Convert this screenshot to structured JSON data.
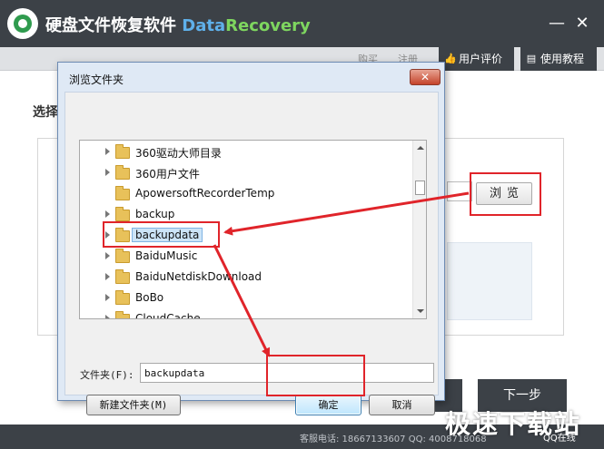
{
  "app": {
    "title_cn": "硬盘文件恢复软件",
    "title_data": "Data",
    "title_recovery": "Recovery",
    "minimize_glyph": "—",
    "close_glyph": "✕"
  },
  "nav": {
    "buy": "购买",
    "register": "注册",
    "review": "用户评价",
    "tutorial": "使用教程",
    "review_icon": "thumbs-up-icon",
    "tutorial_icon": "book-icon"
  },
  "main": {
    "select_label": "选择",
    "browse_button": "浏览",
    "next_button": "下一步"
  },
  "footer": {
    "contact": "客服电话: 18667133607  QQ: 4008718068",
    "qq_online": "QQ在线"
  },
  "watermark": "极速下载站",
  "dialog": {
    "title": "浏览文件夹",
    "close_glyph": "✕",
    "tree_items": [
      {
        "label": "360驱动大师目录",
        "expandable": true
      },
      {
        "label": "360用户文件",
        "expandable": true
      },
      {
        "label": "ApowersoftRecorderTemp",
        "expandable": false
      },
      {
        "label": "backup",
        "expandable": true
      },
      {
        "label": "backupdata",
        "expandable": true,
        "selected": true
      },
      {
        "label": "BaiduMusic",
        "expandable": true
      },
      {
        "label": "BaiduNetdiskDownload",
        "expandable": true
      },
      {
        "label": "BoBo",
        "expandable": true
      },
      {
        "label": "CloudCache",
        "expandable": true
      }
    ],
    "folder_label": "文件夹(F):",
    "folder_value": "backupdata",
    "new_folder_button": "新建文件夹(M)",
    "ok_button": "确定",
    "cancel_button": "取消"
  },
  "colors": {
    "titlebar": "#3c4147",
    "annotation_red": "#e0242a",
    "selection": "#cce4f7"
  }
}
